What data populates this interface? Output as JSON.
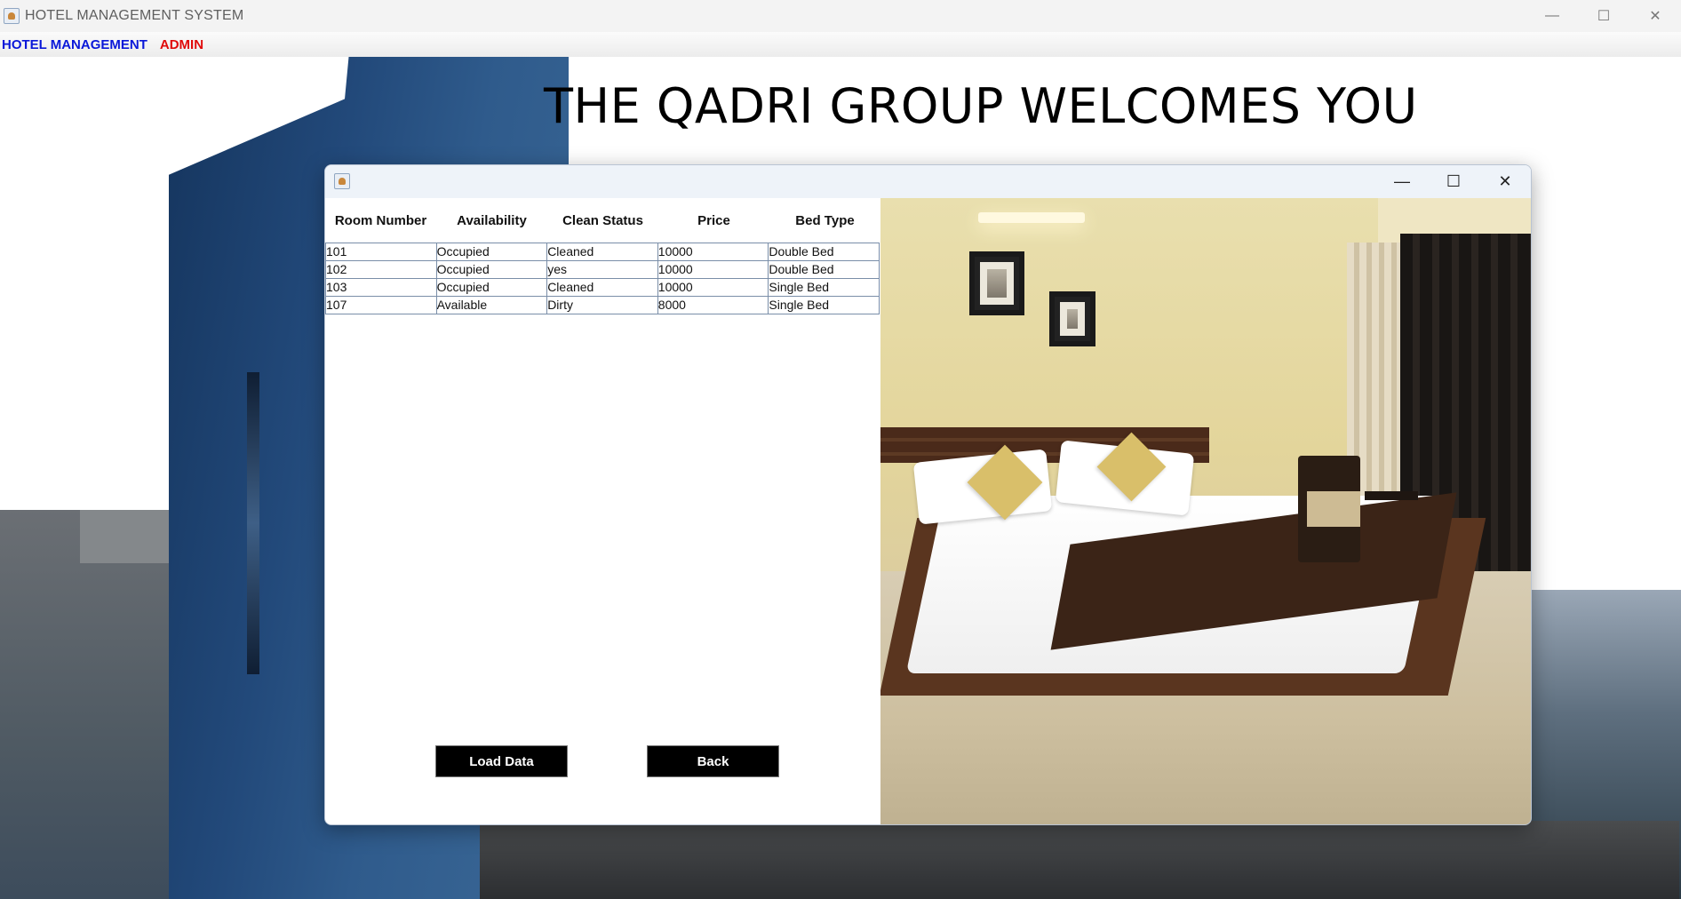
{
  "window": {
    "title": "HOTEL MANAGEMENT SYSTEM",
    "controls": {
      "minimize": "—",
      "maximize": "☐",
      "close": "✕"
    }
  },
  "menubar": {
    "items": [
      {
        "label": "HOTEL MANAGEMENT",
        "color": "#0a18d9"
      },
      {
        "label": "ADMIN",
        "color": "#e00a0a"
      }
    ]
  },
  "hero": {
    "welcome_text": "THE QADRI GROUP WELCOMES YOU"
  },
  "dialog": {
    "title": "",
    "controls": {
      "minimize": "—",
      "maximize": "☐",
      "close": "✕"
    },
    "table": {
      "columns": [
        "Room Number",
        "Availability",
        "Clean Status",
        "Price",
        "Bed Type"
      ],
      "rows": [
        [
          "101",
          "Occupied",
          "Cleaned",
          "10000",
          "Double Bed"
        ],
        [
          "102",
          "Occupied",
          "yes",
          "10000",
          "Double Bed"
        ],
        [
          "103",
          "Occupied",
          "Cleaned",
          "10000",
          "Single Bed"
        ],
        [
          "107",
          "Available",
          "Dirty",
          "8000",
          "Single Bed"
        ]
      ]
    },
    "buttons": {
      "load_data": "Load Data",
      "back": "Back"
    },
    "photo": {
      "description_icon": "hotel-room-photo"
    }
  }
}
